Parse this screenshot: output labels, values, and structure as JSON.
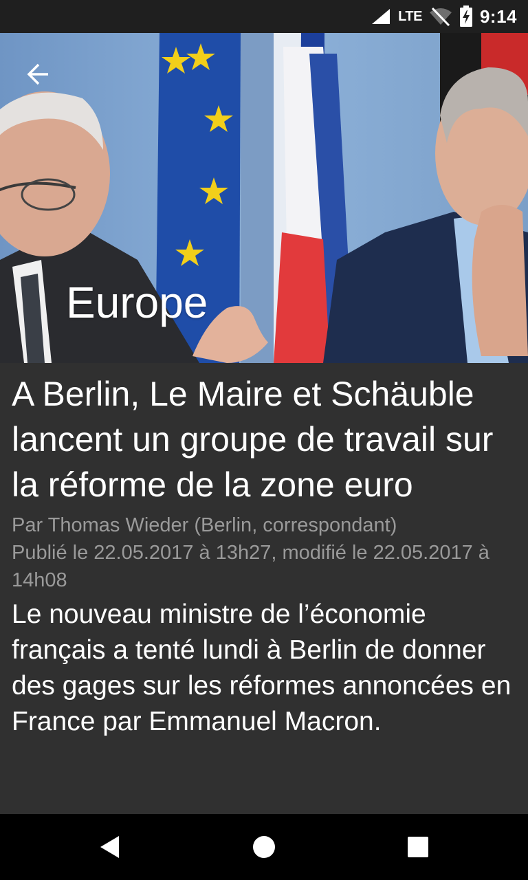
{
  "status_bar": {
    "network_label": "LTE",
    "time": "9:14",
    "icons": [
      "signal-icon",
      "lte-icon",
      "wifi-off-icon",
      "battery-charging-icon"
    ]
  },
  "hero": {
    "section_title": "Europe",
    "back_icon": "arrow-back-icon"
  },
  "article": {
    "headline": "A Berlin, Le Maire et Schäuble lancent un groupe de travail sur la réforme de la zone euro",
    "byline": "Par Thomas Wieder (Berlin, correspondant)",
    "dateline": "Publié le 22.05.2017 à 13h27, modifié le 22.05.2017 à 14h08",
    "lead": "Le nouveau ministre de l’économie français a tenté lundi à Berlin de donner des gages sur les réformes annoncées en France par Emmanuel Macron."
  },
  "nav_bar": {
    "icons": [
      "back-triangle-icon",
      "home-circle-icon",
      "recents-square-icon"
    ]
  },
  "colors": {
    "background": "#303030",
    "status_bar": "#1f1f1f",
    "nav_bar": "#000000",
    "meta_text": "#9a9a9a",
    "text": "#ffffff"
  }
}
